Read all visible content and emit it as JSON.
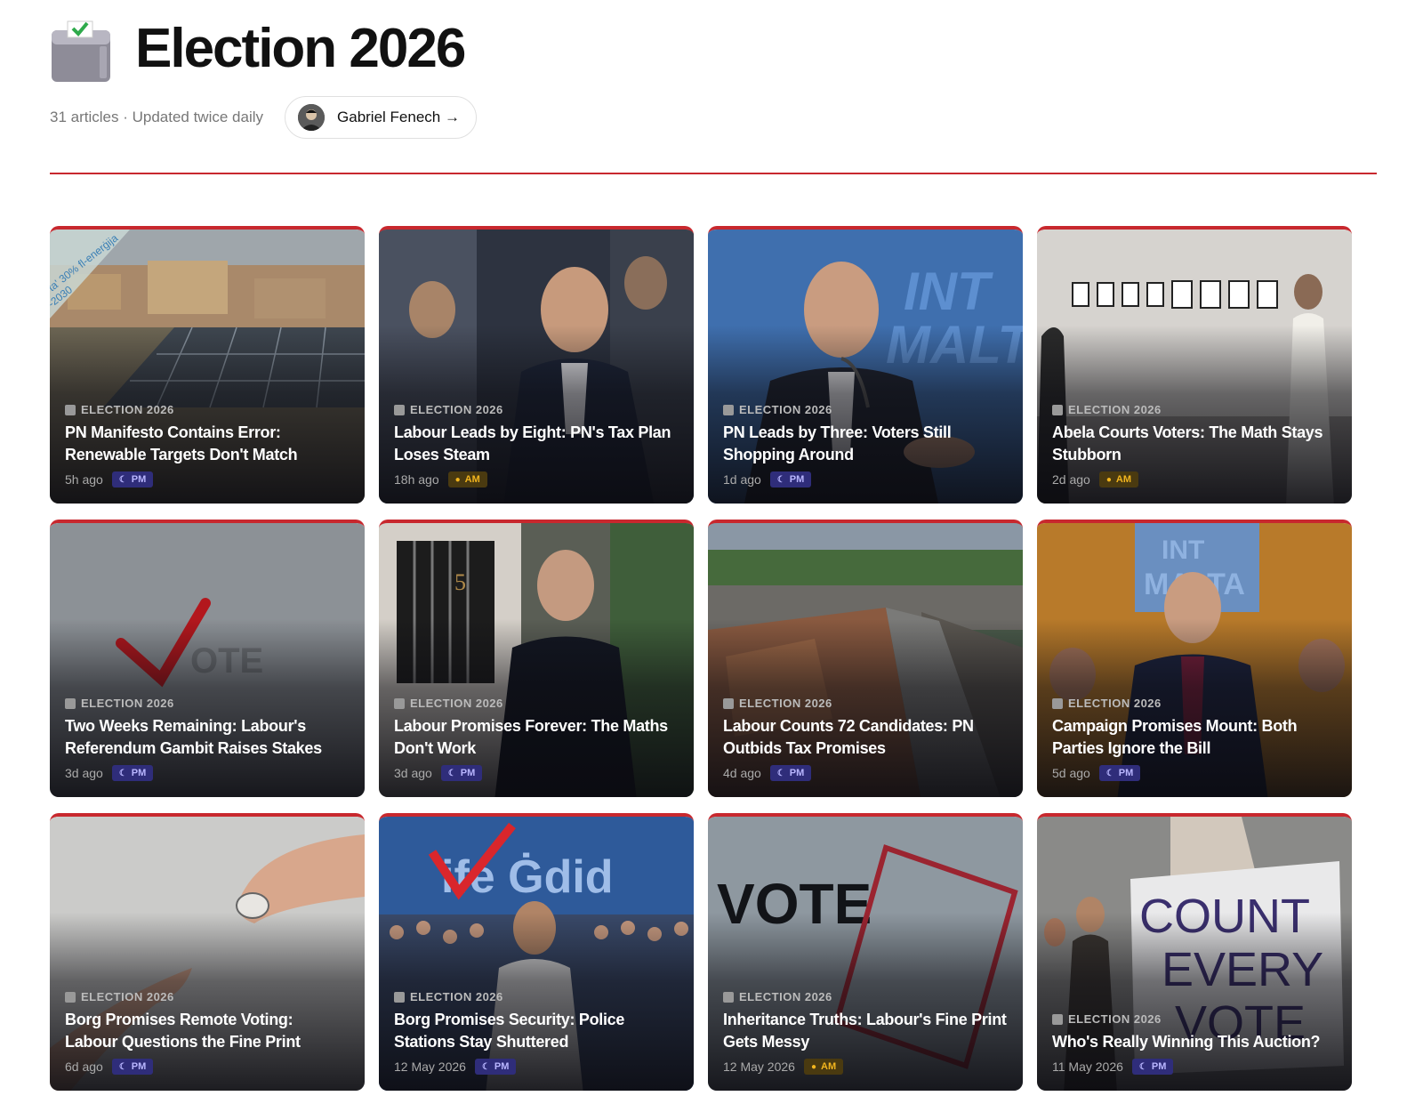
{
  "header": {
    "title": "Election 2026",
    "meta": "31 articles · Updated twice daily",
    "author": "Gabriel Fenech →"
  },
  "colors": {
    "accent": "#c8282e",
    "pm_badge": "#2f2d7a",
    "am_badge": "#f2b51e"
  },
  "cards": [
    {
      "kicker": "ELECTION 2026",
      "headline": "PN Manifesto Contains Error: Renewable Targets Don't Match",
      "time": "5h ago",
      "badge": "PM",
      "img": "solar panels on rooftop with town"
    },
    {
      "kicker": "ELECTION 2026",
      "headline": "Labour Leads by Eight: PN's Tax Plan Loses Steam",
      "time": "18h ago",
      "badge": "AM",
      "img": "smiling politician in crowd"
    },
    {
      "kicker": "ELECTION 2026",
      "headline": "PN Leads by Three: Voters Still Shopping Around",
      "time": "1d ago",
      "badge": "PM",
      "img": "man speaking at podium"
    },
    {
      "kicker": "ELECTION 2026",
      "headline": "Abela Courts Voters: The Math Stays Stubborn",
      "time": "2d ago",
      "badge": "AM",
      "img": "art gallery with framed prints"
    },
    {
      "kicker": "ELECTION 2026",
      "headline": "Two Weeks Remaining: Labour's Referendum Gambit Raises Stakes",
      "time": "3d ago",
      "badge": "PM",
      "img": "vote checkmark"
    },
    {
      "kicker": "ELECTION 2026",
      "headline": "Labour Promises Forever: The Maths Don't Work",
      "time": "3d ago",
      "badge": "PM",
      "img": "man at door"
    },
    {
      "kicker": "ELECTION 2026",
      "headline": "Labour Counts 72 Candidates: PN Outbids Tax Promises",
      "time": "4d ago",
      "badge": "PM",
      "img": "aerial town view"
    },
    {
      "kicker": "ELECTION 2026",
      "headline": "Campaign Promises Mount: Both Parties Ignore the Bill",
      "time": "5d ago",
      "badge": "PM",
      "img": "politician at rally"
    },
    {
      "kicker": "ELECTION 2026",
      "headline": "Borg Promises Remote Voting: Labour Questions the Fine Print",
      "time": "6d ago",
      "badge": "PM",
      "img": "hands passing vote token"
    },
    {
      "kicker": "ELECTION 2026",
      "headline": "Borg Promises Security: Police Stations Stay Shuttered",
      "time": "12 May 2026",
      "badge": "PM",
      "img": "crowd at rally"
    },
    {
      "kicker": "ELECTION 2026",
      "headline": "Inheritance Truths: Labour's Fine Print Gets Messy",
      "time": "12 May 2026",
      "badge": "AM",
      "img": "vote sign with frame"
    },
    {
      "kicker": "ELECTION 2026",
      "headline": "Who's Really Winning This Auction?",
      "time": "11 May 2026",
      "badge": "PM",
      "img": "count every vote protest sign"
    }
  ],
  "image_texts": {
    "card1_banner": "ta' 30% fl-enerġija\n-2030",
    "card3_sign": "INT MALT",
    "card5_vote": "OTE",
    "card6_number": "5",
    "card8_sign": "INT MALTA",
    "card10_sign": "ife Ġdid",
    "card11_vote": "VOTE",
    "card12_sign": [
      "COUNT",
      "EVERY",
      "VOTE"
    ]
  }
}
